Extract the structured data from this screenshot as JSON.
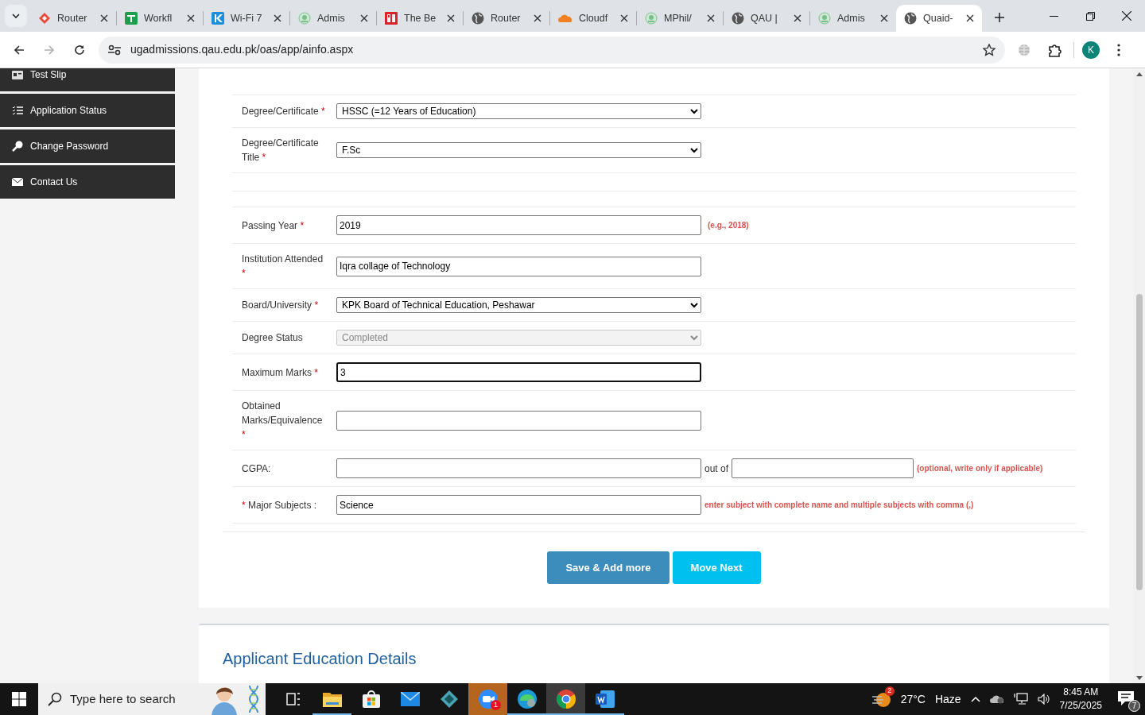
{
  "browser": {
    "tabs": [
      {
        "title": "Router",
        "kind": "router",
        "selected": false
      },
      {
        "title": "Workfl",
        "kind": "sheet",
        "selected": false
      },
      {
        "title": "Wi-Fi 7",
        "kind": "chevron",
        "selected": false
      },
      {
        "title": "Admis",
        "kind": "seal",
        "selected": false
      },
      {
        "title": "The Be",
        "kind": "pc",
        "selected": false
      },
      {
        "title": "Router",
        "kind": "globe",
        "selected": false
      },
      {
        "title": "Cloudf",
        "kind": "cloud",
        "selected": false
      },
      {
        "title": "MPhil/",
        "kind": "seal",
        "selected": false
      },
      {
        "title": "QAU |",
        "kind": "globe",
        "selected": false
      },
      {
        "title": "Admis",
        "kind": "seal",
        "selected": false
      },
      {
        "title": "Quaid-",
        "kind": "globe",
        "selected": true
      }
    ],
    "address": "ugadmissions.qau.edu.pk/oas/app/ainfo.aspx",
    "forward_disabled": true,
    "profile_initial": "K"
  },
  "sidebar": {
    "items": [
      {
        "label": "Test Slip",
        "kind": "card"
      },
      {
        "label": "Application Status",
        "kind": "list"
      },
      {
        "label": "Change Password",
        "kind": "key"
      },
      {
        "label": "Contact Us",
        "kind": "envelope"
      }
    ]
  },
  "form": {
    "rows": [
      {
        "label": "Degree/Certificate",
        "required_mark": "*",
        "kind": "select",
        "value": "HSSC (=12 Years of Education)",
        "disabled": false,
        "focused": false
      },
      {
        "label": "Degree/Certificate Title",
        "required_mark": "*",
        "kind": "select",
        "value": "F.Sc",
        "disabled": false,
        "focused": false
      },
      {
        "label": "Passing Year",
        "required_mark": "*",
        "kind": "input",
        "value": "2019",
        "hint": "(e.g., 2018)",
        "divider_before": true,
        "disabled": false,
        "focused": false
      },
      {
        "label": "Institution Attended",
        "required_mark": "*",
        "kind": "input",
        "value": "Iqra collage of Technology",
        "disabled": false,
        "focused": false
      },
      {
        "label": "Board/University",
        "required_mark": "*",
        "kind": "select",
        "value": "KPK Board of Technical Education, Peshawar",
        "disabled": false,
        "focused": false
      },
      {
        "label": "Degree Status",
        "kind": "select",
        "value": "Completed",
        "disabled": true,
        "focused": false
      },
      {
        "label": "Maximum Marks",
        "required_mark": "*",
        "kind": "input",
        "value": "3",
        "disabled": false,
        "focused": true
      },
      {
        "label": "Obtained Marks/Equivalence",
        "required_mark": "*",
        "kind": "input",
        "disabled": false,
        "focused": false
      },
      {
        "label": "CGPA:",
        "kind": "range",
        "joiner": "out of",
        "hint": "(optional, write only if applicable)",
        "disabled": false,
        "focused": false
      },
      {
        "label": "Major Subjects :",
        "required_mark": "*",
        "mark_first": true,
        "kind": "input",
        "value": "Science",
        "hint": "enter subject with complete name and multiple subjects with comma (,)",
        "disabled": false,
        "focused": false
      }
    ],
    "buttons": [
      {
        "label": "Save & Add more",
        "kind": "primary"
      },
      {
        "label": "Move Next",
        "kind": "info"
      }
    ]
  },
  "next_section": {
    "title": "Applicant Education Details"
  },
  "taskbar": {
    "search_placeholder": "Type here to search",
    "apps": [
      {
        "kind": "task-view",
        "running": false,
        "selected": false,
        "flashing": false
      },
      {
        "kind": "folder",
        "running": true,
        "selected": false,
        "flashing": false
      },
      {
        "kind": "store",
        "running": false,
        "selected": false,
        "flashing": false
      },
      {
        "kind": "mail",
        "running": false,
        "selected": false,
        "flashing": false
      },
      {
        "kind": "diamond",
        "running": false,
        "selected": false,
        "flashing": false
      },
      {
        "kind": "video",
        "running": false,
        "selected": false,
        "flashing": true,
        "badge": "1"
      },
      {
        "kind": "edge",
        "running": true,
        "selected": false,
        "flashing": false
      },
      {
        "kind": "chrome",
        "running": true,
        "selected": true,
        "flashing": false
      },
      {
        "kind": "word",
        "running": true,
        "selected": false,
        "flashing": false
      }
    ],
    "weather": {
      "badge": "2",
      "temperature": "27°C",
      "condition": "Haze"
    },
    "time": "8:45 AM",
    "date": "7/25/2025",
    "notifications": "7"
  }
}
